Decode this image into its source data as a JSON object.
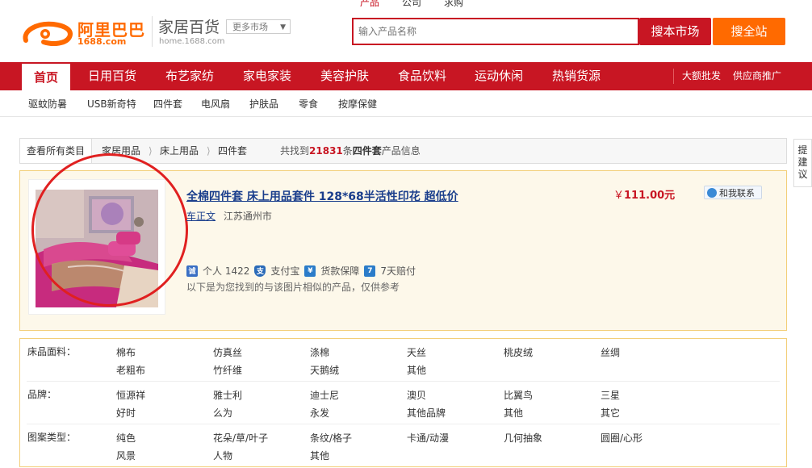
{
  "top_tabs": [
    "产品",
    "公司",
    "求购"
  ],
  "logo": {
    "text": "阿里巴巴",
    "sub": "1688.com"
  },
  "site": {
    "title": "家居百货",
    "url": "home.1688.com",
    "more_market": "更多市场"
  },
  "search": {
    "placeholder": "输入产品名称",
    "button": "搜本市场",
    "button_all": "搜全站"
  },
  "nav": {
    "items": [
      "首页",
      "日用百货",
      "布艺家纺",
      "家电家装",
      "美容护肤",
      "食品饮料",
      "运动休闲",
      "热销货源"
    ],
    "right": [
      "大额批发",
      "供应商推广"
    ]
  },
  "subnav": [
    "驱蚊防暑",
    "USB新奇特",
    "四件套",
    "电风扇",
    "护肤品",
    "零食",
    "按摩保健"
  ],
  "breadcrumb": {
    "all": "查看所有类目",
    "path": [
      "家居用品",
      "床上用品",
      "四件套"
    ],
    "found_prefix": "共找到",
    "count": "21831",
    "found_mid": "条",
    "keyword": "四件套",
    "found_suffix": "产品信息"
  },
  "suggest": "提建议",
  "product": {
    "title": "全棉四件套 床上用品套件 128*68半活性印花 超低价",
    "seller": "车正文",
    "location": "江苏通州市",
    "price": "111.00元",
    "currency": "￥",
    "contact": "和我联系",
    "badges": [
      {
        "icon": "诚",
        "color": "#3a6fc4",
        "label": "个人 1422"
      },
      {
        "icon": "支",
        "color": "#2a6ab8",
        "label": "支付宝"
      },
      {
        "icon": "¥",
        "color": "#2b7cc9",
        "label": "货款保障"
      },
      {
        "icon": "7",
        "color": "#2b7cc9",
        "label": "7天赔付"
      }
    ],
    "similar_note": "以下是为您找到的与该图片相似的产品，仅供参考"
  },
  "filters": [
    {
      "label": "床品面料：",
      "rows": [
        [
          "棉布",
          "仿真丝",
          "涤棉",
          "天丝",
          "桃皮绒",
          "丝绸"
        ],
        [
          "老粗布",
          "竹纤维",
          "天鹅绒",
          "其他"
        ]
      ]
    },
    {
      "label": "品牌：",
      "rows": [
        [
          "恒源祥",
          "雅士利",
          "迪士尼",
          "澳贝",
          "比翼鸟",
          "三星"
        ],
        [
          "好时",
          "么为",
          "永发",
          "其他品牌",
          "其他",
          "其它"
        ]
      ]
    },
    {
      "label": "图案类型：",
      "rows": [
        [
          "纯色",
          "花朵/草/叶子",
          "条纹/格子",
          "卡通/动漫",
          "几何抽象",
          "圆圈/心形"
        ],
        [
          "风景",
          "人物",
          "其他"
        ]
      ]
    }
  ]
}
